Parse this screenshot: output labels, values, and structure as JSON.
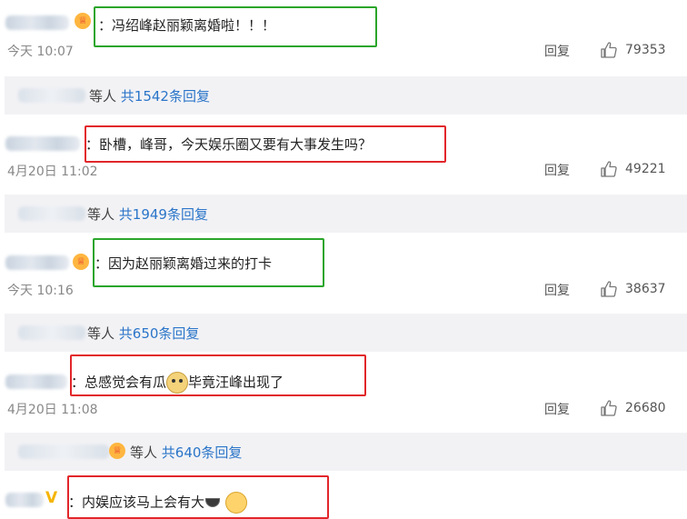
{
  "reply_label": "回复",
  "comments": [
    {
      "text": "：冯绍峰赵丽颖离婚啦！！！",
      "time": "今天 10:07",
      "likes": "79353",
      "thread": {
        "prefix": "等人",
        "more": "共1542条回复"
      }
    },
    {
      "text": "：卧槽，峰哥，今天娱乐圈又要有大事发生吗？",
      "time": "4月20日 11:02",
      "likes": "49221",
      "thread": {
        "prefix": "等人",
        "more": "共1949条回复"
      }
    },
    {
      "text": "：因为赵丽颖离婚过来的打卡",
      "time": "今天 10:16",
      "likes": "38637",
      "thread": {
        "prefix": "等人",
        "more": "共650条回复"
      }
    },
    {
      "text_a": "：总感觉会有瓜",
      "text_b": "毕竟汪峰出现了",
      "time": "4月20日 11:08",
      "likes": "26680",
      "thread": {
        "prefix": "等人",
        "more": "共640条回复"
      }
    },
    {
      "text": "：内娱应该马上会有大"
    }
  ],
  "icons": {
    "like": "thumbs-up-icon",
    "vip_badge": "crown-badge-icon",
    "v_badge": "verified-v-icon",
    "doge": "doge-emoji-icon",
    "melon": "melon-emoji-icon",
    "pray": "pray-emoji-icon"
  },
  "colors": {
    "green_box": "#2aa52a",
    "red_box": "#e2262a",
    "link": "#2b75c9",
    "thread_bg": "#f2f2f5"
  }
}
